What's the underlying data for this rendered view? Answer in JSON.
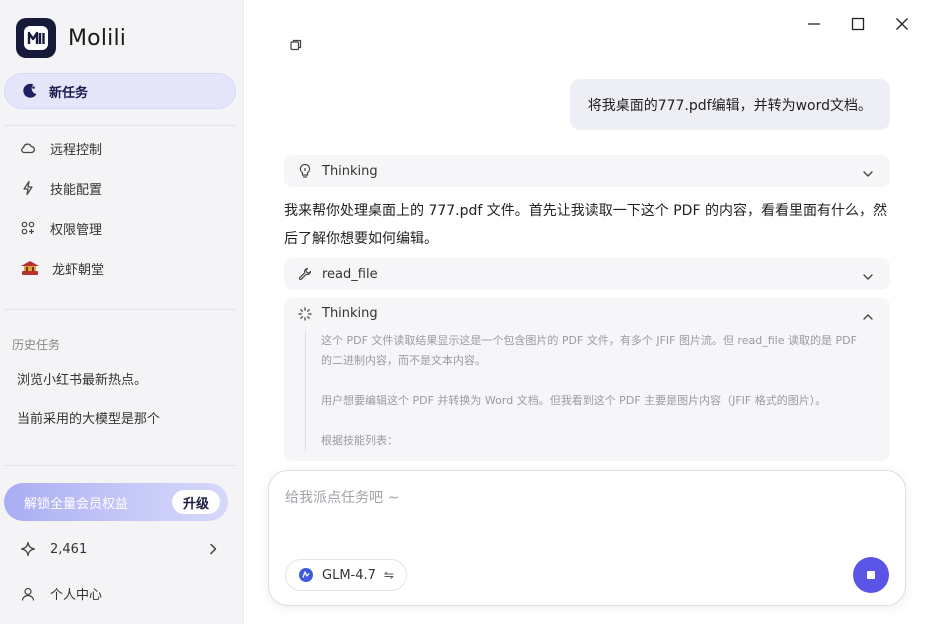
{
  "brand": {
    "name": "Molili",
    "logo_text": "M"
  },
  "sidebar": {
    "new_task_label": "新任务",
    "nav_items": [
      {
        "label": "远程控制",
        "icon": "cloud-icon"
      },
      {
        "label": "技能配置",
        "icon": "lightning-icon"
      },
      {
        "label": "权限管理",
        "icon": "grid-icon"
      },
      {
        "label": "龙虾朝堂",
        "icon": "court-icon"
      }
    ],
    "history_title": "历史任务",
    "history_items": [
      "浏览小红书最新热点。",
      "当前采用的大模型是那个"
    ],
    "vip_label": "解锁全量会员权益",
    "upgrade_label": "升级",
    "points_value": "2,461",
    "profile_label": "个人中心"
  },
  "chat": {
    "user_message": "将我桌面的777.pdf编辑，并转为word文档。",
    "thinking_label_1": "Thinking",
    "assistant_text": "我来帮你处理桌面上的 777.pdf 文件。首先让我读取一下这个 PDF 的内容，看看里面有什么，然后了解你想要如何编辑。",
    "tool_label": "read_file",
    "thinking_label_2": "Thinking",
    "thinking_lines": [
      "这个 PDF 文件读取结果显示这是一个包含图片的 PDF 文件，有多个 JFIF 图片流。但 read_file 读取的是 PDF 的二进制内容，而不是文本内容。",
      "用户想要编辑这个 PDF 并转换为 Word 文档。但我看到这个 PDF 主要是图片内容（JFIF 格式的图片）。",
      "根据技能列表："
    ]
  },
  "composer": {
    "placeholder": "给我派点任务吧 ~",
    "model_name": "GLM-4.7",
    "swap_symbol": "⇋"
  },
  "colors": {
    "accent": "#5b55e6",
    "sidebar_bg": "#f4f4f7",
    "new_task_bg": "#e6e6fb"
  }
}
